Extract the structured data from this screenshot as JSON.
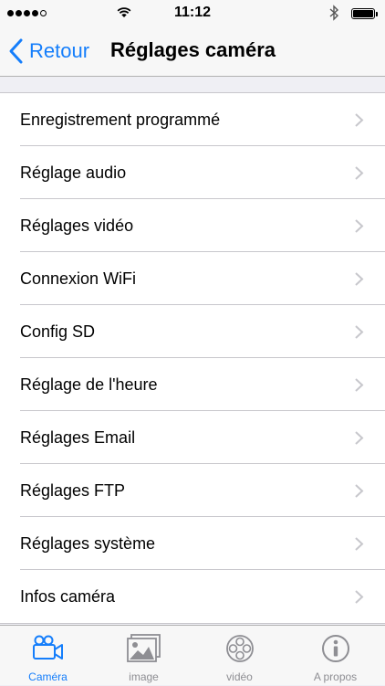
{
  "status_bar": {
    "time": "11:12",
    "signal_strength": 4,
    "signal_dots": 5,
    "battery_level": 1.0
  },
  "nav": {
    "back_label": "Retour",
    "title": "Réglages caméra",
    "accent_color": "#157efb"
  },
  "settings": {
    "items": [
      {
        "label": "Enregistrement programmé"
      },
      {
        "label": "Réglage audio"
      },
      {
        "label": "Réglages vidéo"
      },
      {
        "label": "Connexion WiFi"
      },
      {
        "label": "Config SD"
      },
      {
        "label": "Réglage de l'heure"
      },
      {
        "label": "Réglages Email"
      },
      {
        "label": "Réglages FTP"
      },
      {
        "label": "Réglages système"
      },
      {
        "label": "Infos caméra"
      }
    ]
  },
  "tabs": [
    {
      "label": "Caméra",
      "icon": "video-camera-icon",
      "active": true
    },
    {
      "label": "image",
      "icon": "photo-icon",
      "active": false
    },
    {
      "label": "vidéo",
      "icon": "film-reel-icon",
      "active": false
    },
    {
      "label": "A propos",
      "icon": "info-icon",
      "active": false
    }
  ]
}
